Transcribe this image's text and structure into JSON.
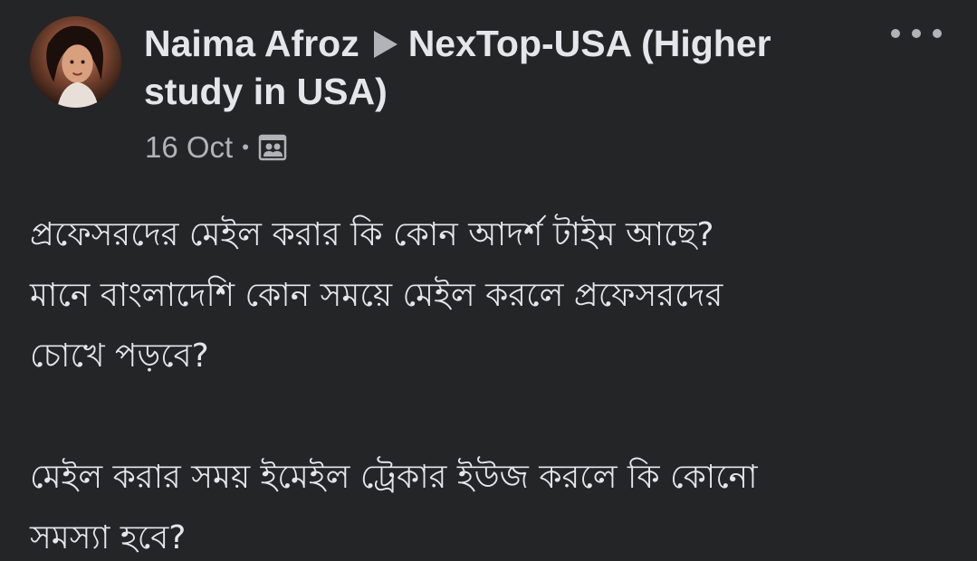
{
  "post": {
    "author": "Naima Afroz",
    "group": "NexTop-USA (Higher study in USA)",
    "date": "16 Oct",
    "separator": "•",
    "privacy_icon": "members-group-icon",
    "more_icon": "more-dots-icon",
    "body_paragraphs": [
      [
        "প্রফেসরদের মেইল করার কি কোন আদর্শ টাইম আছে?",
        "মানে বাংলাদেশি কোন সময়ে মেইল করলে প্রফেসরদের",
        "চোখে পড়বে?"
      ],
      [
        "মেইল করার সময় ইমেইল ট্রেকার ইউজ করলে কি কোনো",
        "সমস্যা হবে?"
      ]
    ]
  },
  "colors": {
    "background": "#242526",
    "primary_text": "#e4e6eb",
    "secondary_text": "#b0b3b8"
  }
}
